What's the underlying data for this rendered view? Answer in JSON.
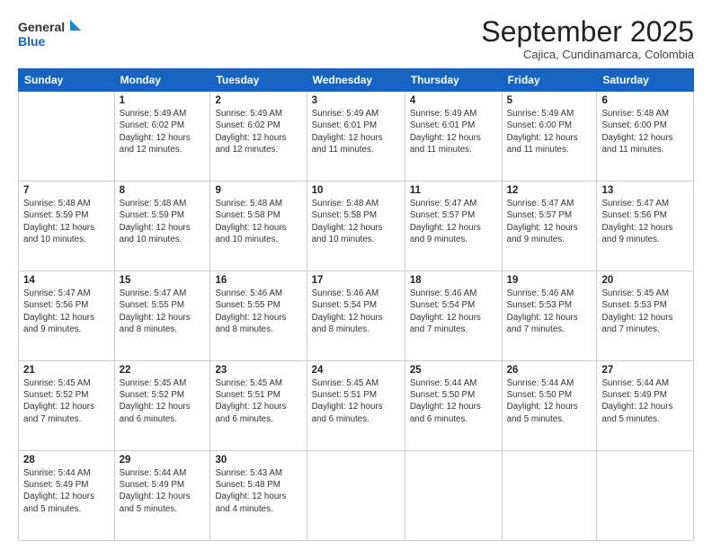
{
  "logo": {
    "line1": "General",
    "line2": "Blue"
  },
  "header": {
    "month": "September 2025",
    "location": "Cajica, Cundinamarca, Colombia"
  },
  "weekdays": [
    "Sunday",
    "Monday",
    "Tuesday",
    "Wednesday",
    "Thursday",
    "Friday",
    "Saturday"
  ],
  "weeks": [
    [
      {
        "day": "",
        "detail": ""
      },
      {
        "day": "1",
        "detail": "Sunrise: 5:49 AM\nSunset: 6:02 PM\nDaylight: 12 hours\nand 12 minutes."
      },
      {
        "day": "2",
        "detail": "Sunrise: 5:49 AM\nSunset: 6:02 PM\nDaylight: 12 hours\nand 12 minutes."
      },
      {
        "day": "3",
        "detail": "Sunrise: 5:49 AM\nSunset: 6:01 PM\nDaylight: 12 hours\nand 11 minutes."
      },
      {
        "day": "4",
        "detail": "Sunrise: 5:49 AM\nSunset: 6:01 PM\nDaylight: 12 hours\nand 11 minutes."
      },
      {
        "day": "5",
        "detail": "Sunrise: 5:49 AM\nSunset: 6:00 PM\nDaylight: 12 hours\nand 11 minutes."
      },
      {
        "day": "6",
        "detail": "Sunrise: 5:48 AM\nSunset: 6:00 PM\nDaylight: 12 hours\nand 11 minutes."
      }
    ],
    [
      {
        "day": "7",
        "detail": "Sunrise: 5:48 AM\nSunset: 5:59 PM\nDaylight: 12 hours\nand 10 minutes."
      },
      {
        "day": "8",
        "detail": "Sunrise: 5:48 AM\nSunset: 5:59 PM\nDaylight: 12 hours\nand 10 minutes."
      },
      {
        "day": "9",
        "detail": "Sunrise: 5:48 AM\nSunset: 5:58 PM\nDaylight: 12 hours\nand 10 minutes."
      },
      {
        "day": "10",
        "detail": "Sunrise: 5:48 AM\nSunset: 5:58 PM\nDaylight: 12 hours\nand 10 minutes."
      },
      {
        "day": "11",
        "detail": "Sunrise: 5:47 AM\nSunset: 5:57 PM\nDaylight: 12 hours\nand 9 minutes."
      },
      {
        "day": "12",
        "detail": "Sunrise: 5:47 AM\nSunset: 5:57 PM\nDaylight: 12 hours\nand 9 minutes."
      },
      {
        "day": "13",
        "detail": "Sunrise: 5:47 AM\nSunset: 5:56 PM\nDaylight: 12 hours\nand 9 minutes."
      }
    ],
    [
      {
        "day": "14",
        "detail": "Sunrise: 5:47 AM\nSunset: 5:56 PM\nDaylight: 12 hours\nand 9 minutes."
      },
      {
        "day": "15",
        "detail": "Sunrise: 5:47 AM\nSunset: 5:55 PM\nDaylight: 12 hours\nand 8 minutes."
      },
      {
        "day": "16",
        "detail": "Sunrise: 5:46 AM\nSunset: 5:55 PM\nDaylight: 12 hours\nand 8 minutes."
      },
      {
        "day": "17",
        "detail": "Sunrise: 5:46 AM\nSunset: 5:54 PM\nDaylight: 12 hours\nand 8 minutes."
      },
      {
        "day": "18",
        "detail": "Sunrise: 5:46 AM\nSunset: 5:54 PM\nDaylight: 12 hours\nand 7 minutes."
      },
      {
        "day": "19",
        "detail": "Sunrise: 5:46 AM\nSunset: 5:53 PM\nDaylight: 12 hours\nand 7 minutes."
      },
      {
        "day": "20",
        "detail": "Sunrise: 5:45 AM\nSunset: 5:53 PM\nDaylight: 12 hours\nand 7 minutes."
      }
    ],
    [
      {
        "day": "21",
        "detail": "Sunrise: 5:45 AM\nSunset: 5:52 PM\nDaylight: 12 hours\nand 7 minutes."
      },
      {
        "day": "22",
        "detail": "Sunrise: 5:45 AM\nSunset: 5:52 PM\nDaylight: 12 hours\nand 6 minutes."
      },
      {
        "day": "23",
        "detail": "Sunrise: 5:45 AM\nSunset: 5:51 PM\nDaylight: 12 hours\nand 6 minutes."
      },
      {
        "day": "24",
        "detail": "Sunrise: 5:45 AM\nSunset: 5:51 PM\nDaylight: 12 hours\nand 6 minutes."
      },
      {
        "day": "25",
        "detail": "Sunrise: 5:44 AM\nSunset: 5:50 PM\nDaylight: 12 hours\nand 6 minutes."
      },
      {
        "day": "26",
        "detail": "Sunrise: 5:44 AM\nSunset: 5:50 PM\nDaylight: 12 hours\nand 5 minutes."
      },
      {
        "day": "27",
        "detail": "Sunrise: 5:44 AM\nSunset: 5:49 PM\nDaylight: 12 hours\nand 5 minutes."
      }
    ],
    [
      {
        "day": "28",
        "detail": "Sunrise: 5:44 AM\nSunset: 5:49 PM\nDaylight: 12 hours\nand 5 minutes."
      },
      {
        "day": "29",
        "detail": "Sunrise: 5:44 AM\nSunset: 5:49 PM\nDaylight: 12 hours\nand 5 minutes."
      },
      {
        "day": "30",
        "detail": "Sunrise: 5:43 AM\nSunset: 5:48 PM\nDaylight: 12 hours\nand 4 minutes."
      },
      {
        "day": "",
        "detail": ""
      },
      {
        "day": "",
        "detail": ""
      },
      {
        "day": "",
        "detail": ""
      },
      {
        "day": "",
        "detail": ""
      }
    ]
  ]
}
